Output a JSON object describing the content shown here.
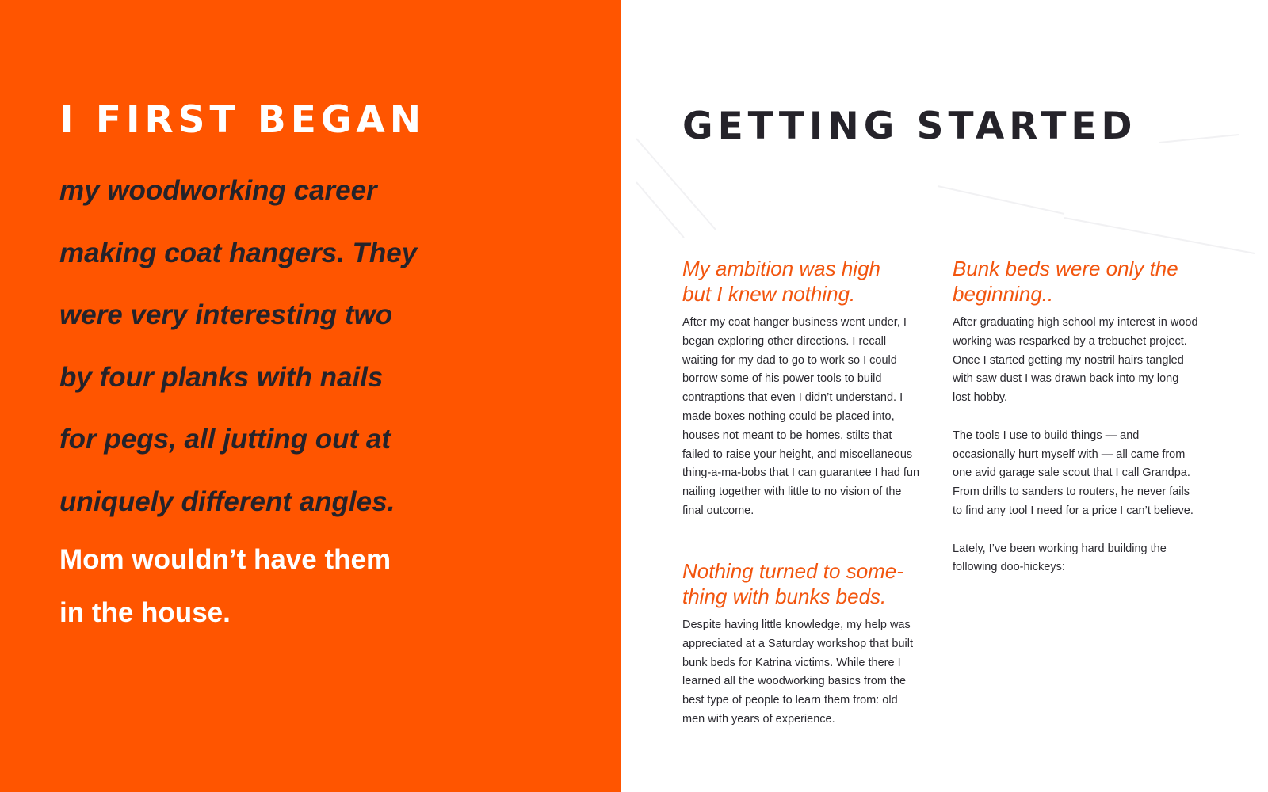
{
  "colors": {
    "accent": "#ff5500",
    "dark_text": "#25232a",
    "subhead": "#f2550e",
    "page_background": "#ffffff"
  },
  "left": {
    "heading": "I FIRST BEGAN",
    "quote_lines": [
      "my woodworking career",
      "making coat hangers. They",
      "were very interesting two",
      "by four planks with nails",
      "for pegs, all jutting out at",
      "uniquely different angles."
    ],
    "closing_lines": [
      "Mom wouldn’t have them",
      "in the house."
    ]
  },
  "right": {
    "heading": "GETTING STARTED",
    "sections": [
      {
        "subhead_lines": [
          "My ambition was high",
          "but I knew nothing."
        ],
        "paragraphs": [
          "After my coat hanger business went under, I began exploring other directions. I recall waiting for my dad to go to work so I could borrow some of his power tools to build contraptions that even I didn’t understand. I made boxes nothing could be placed into, houses not meant to be homes, stilts that failed to raise your height, and miscellaneous thing-a-ma-bobs that I can guarantee I had fun nailing together with little to no vision of the final outcome."
        ]
      },
      {
        "subhead_lines": [
          "Nothing turned to some-",
          "thing with bunks beds."
        ],
        "paragraphs": [
          "Despite having little knowledge, my help was appreciated at a Saturday workshop that built bunk beds for Katrina victims. While there I learned all the woodworking basics from the best type of people to learn them from: old men with years of experience."
        ]
      },
      {
        "subhead_lines": [
          "Bunk beds were only the",
          "beginning.."
        ],
        "paragraphs": [
          "After graduating high school my interest in wood working was resparked by a trebuchet project. Once I started getting my nostril hairs tangled with saw dust I was drawn back into my long lost hobby.",
          "The tools I use to build things  — and occasionally hurt myself with — all came from one avid garage sale scout that I call Grandpa. From drills to sanders to routers, he never fails to find any tool I need for a price I can’t believe.",
          "Lately, I’ve been working hard building the following doo-hickeys:"
        ]
      }
    ]
  }
}
